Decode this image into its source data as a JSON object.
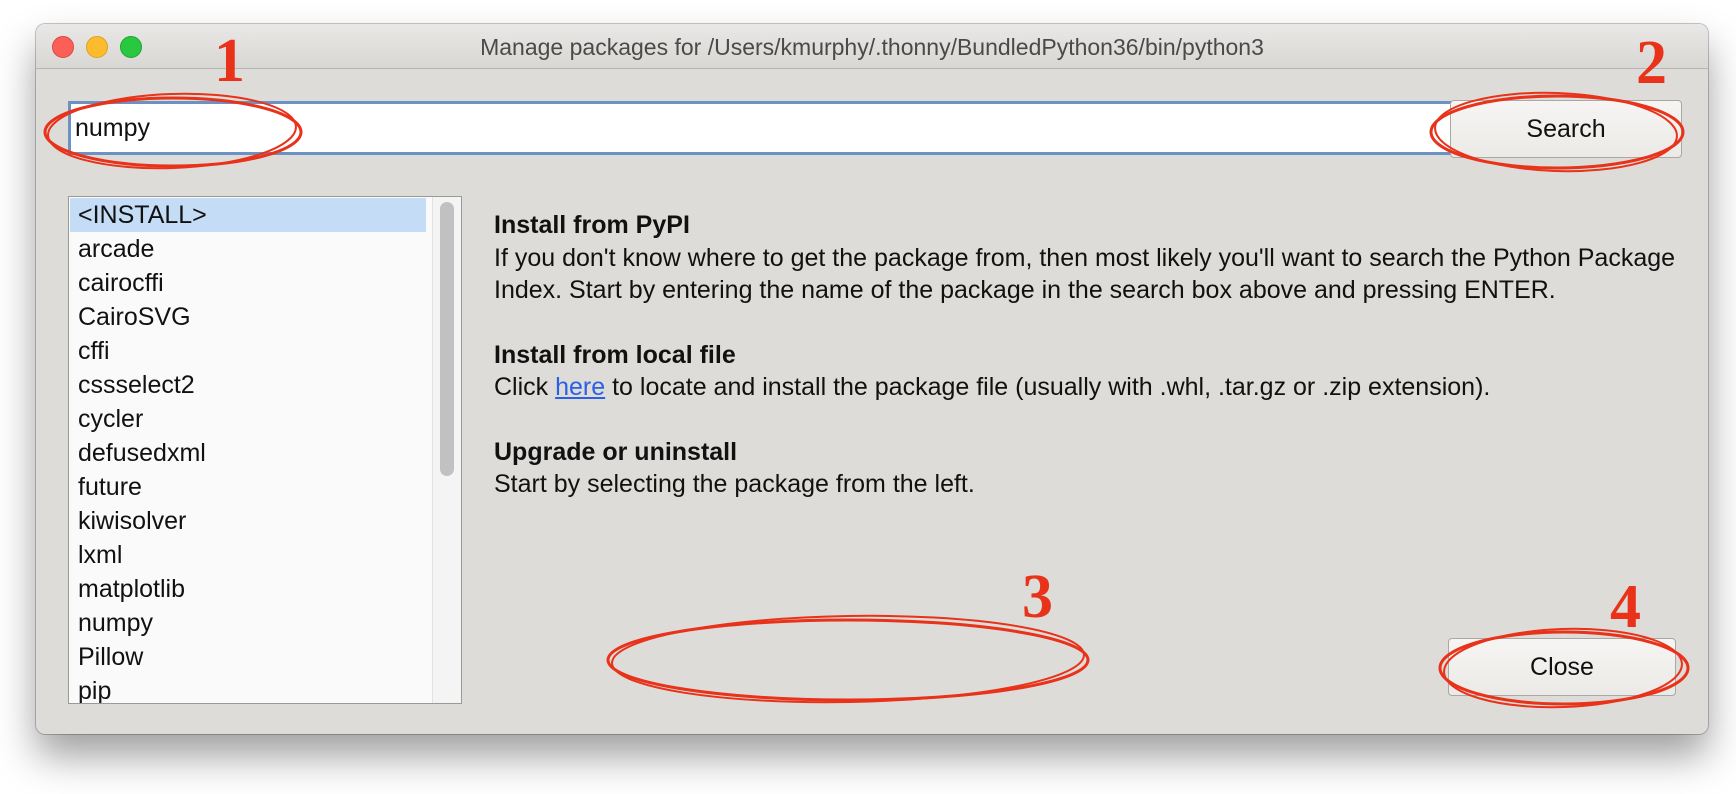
{
  "window": {
    "title": "Manage packages for /Users/kmurphy/.thonny/BundledPython36/bin/python3"
  },
  "search": {
    "value": "numpy",
    "button_label": "Search"
  },
  "packages": {
    "items": [
      "<INSTALL>",
      "arcade",
      "cairocffi",
      "CairoSVG",
      "cffi",
      "cssselect2",
      "cycler",
      "defusedxml",
      "future",
      "kiwisolver",
      "lxml",
      "matplotlib",
      "numpy",
      "Pillow",
      "pip"
    ],
    "selected": "<INSTALL>"
  },
  "info": {
    "pypi_heading": "Install from PyPI",
    "pypi_text": "If you don't know where to get the package from, then most likely you'll want to search the Python Package Index. Start by entering the name of the package in the search box above and pressing ENTER.",
    "local_heading": "Install from local file",
    "local_text_before": "Click ",
    "local_link": "here",
    "local_text_after": " to locate and install the package file (usually with .whl, .tar.gz or .zip extension).",
    "upgrade_heading": "Upgrade or uninstall",
    "upgrade_text": "Start by selecting the package from the left."
  },
  "close_button_label": "Close",
  "annotations": {
    "color": "#e8321a",
    "labels": [
      "1",
      "2",
      "3",
      "4"
    ]
  }
}
